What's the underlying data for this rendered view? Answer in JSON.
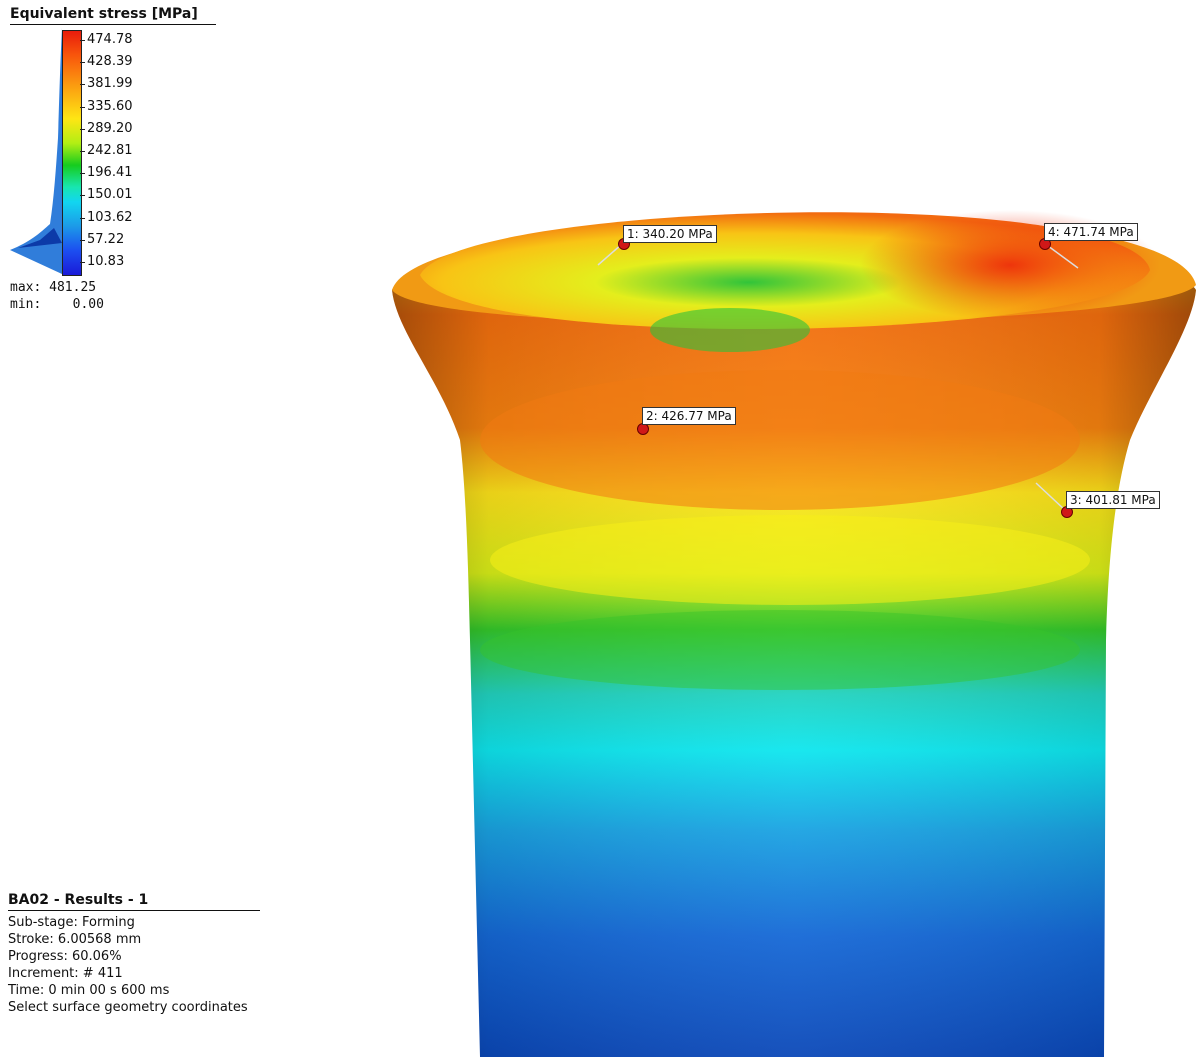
{
  "legend": {
    "title": "Equivalent stress [MPa]",
    "ticks": [
      "474.78",
      "428.39",
      "381.99",
      "335.60",
      "289.20",
      "242.81",
      "196.41",
      "150.01",
      "103.62",
      "57.22",
      "10.83"
    ],
    "max_label": "max: 481.25",
    "min_label": "min:    0.00"
  },
  "probes": [
    {
      "label": "1: 340.20 MPa"
    },
    {
      "label": "4: 471.74 MPa"
    },
    {
      "label": "2: 426.77 MPa"
    },
    {
      "label": "3: 401.81 MPa"
    }
  ],
  "info": {
    "title": "BA02 - Results - 1",
    "lines": [
      "Sub-stage: Forming",
      "Stroke: 6.00568 mm",
      "Progress: 60.06%",
      "Increment: # 411",
      "Time: 0 min 00 s 600 ms",
      "Select surface geometry coordinates"
    ]
  },
  "colors": {
    "high": "#e81c0c",
    "mid": "#fee614",
    "green": "#16cc1e",
    "cyan": "#12d6f0",
    "low": "#1a1ad8"
  }
}
